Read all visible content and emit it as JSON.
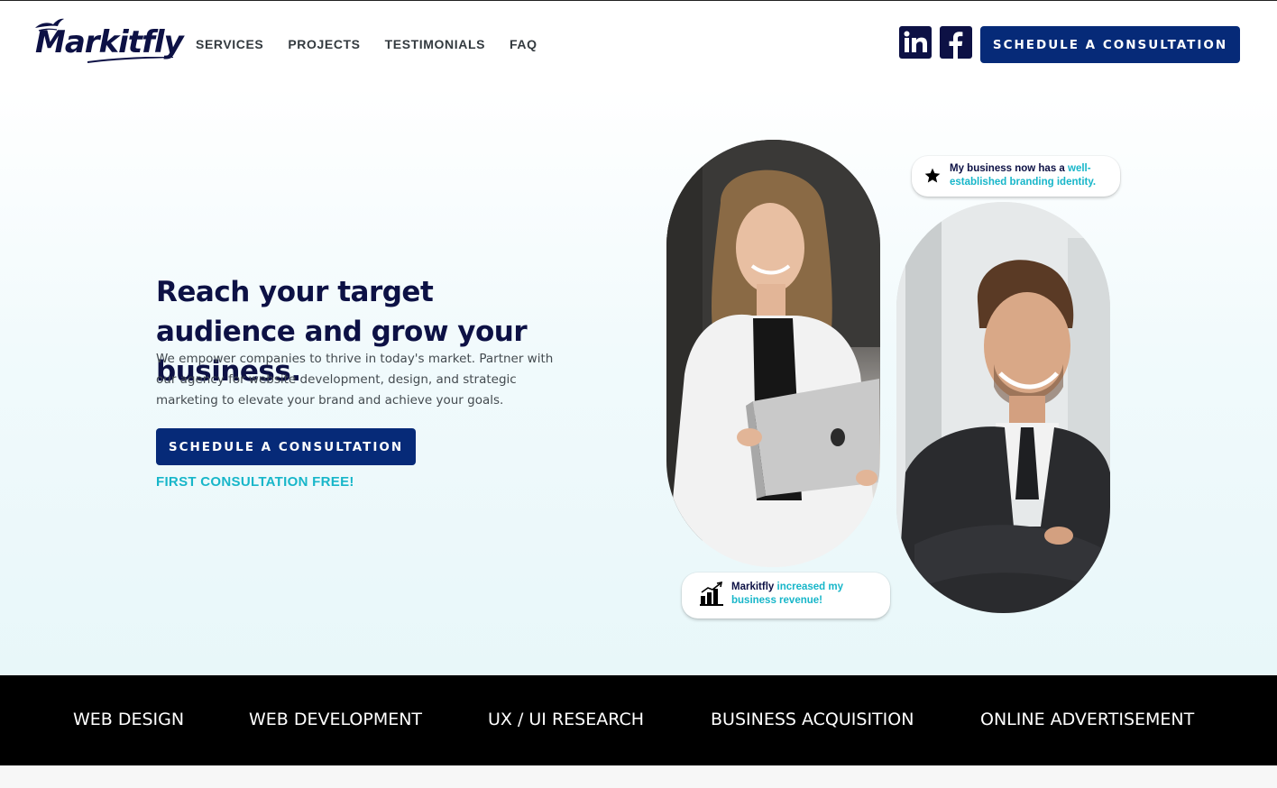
{
  "brand": {
    "logo_text": "Markitfly"
  },
  "nav": {
    "items": [
      {
        "label": "SERVICES"
      },
      {
        "label": "PROJECTS"
      },
      {
        "label": "TESTIMONIALS"
      },
      {
        "label": "FAQ"
      }
    ]
  },
  "social": {
    "linkedin": "linkedin-icon",
    "facebook": "facebook-icon"
  },
  "header": {
    "cta_label": "SCHEDULE A CONSULTATION"
  },
  "hero": {
    "title": "Reach your target audience and grow your business.",
    "description": "We empower companies to thrive in today's market. Partner with our agency for website development, design, and strategic marketing to elevate your brand and achieve your goals.",
    "cta_label": "SCHEDULE A CONSULTATION",
    "free_note": "FIRST CONSULTATION FREE!"
  },
  "testimonials": {
    "top": {
      "prefix": "My business now has a ",
      "accent": "well-established branding identity."
    },
    "bottom": {
      "prefix": "Markitfly ",
      "accent": "increased my business revenue!"
    }
  },
  "services": [
    {
      "label": "WEB DESIGN"
    },
    {
      "label": "WEB DEVELOPMENT"
    },
    {
      "label": "UX / UI RESEARCH"
    },
    {
      "label": "BUSINESS ACQUISITION"
    },
    {
      "label": "ONLINE ADVERTISEMENT"
    }
  ],
  "colors": {
    "primary": "#062a78",
    "accent": "#17b6c9",
    "heading": "#0d1145",
    "services_bg": "#000000"
  }
}
